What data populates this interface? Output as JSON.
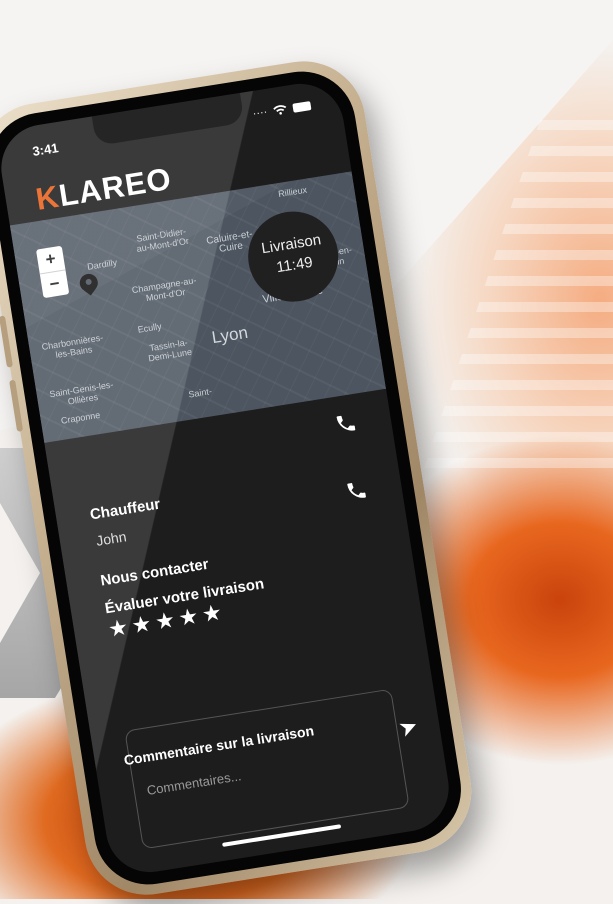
{
  "status_bar": {
    "time": "3:41",
    "signal": "····",
    "wifi_icon": "wifi-icon",
    "battery_icon": "battery-icon"
  },
  "app": {
    "logo_initial": "K",
    "logo_rest": "LAREO",
    "accent": "#e8601a"
  },
  "map": {
    "zoom_in": "+",
    "zoom_out": "−",
    "labels": [
      "Rillieux",
      "Saint-Didier-au-Mont-d'Or",
      "Caluire-et-Cuire",
      "Champagne-au-Mont-d'Or",
      "Charbonnières-les-Bains",
      "Ecully",
      "Tassin-la-Demi-Lune",
      "Lyon",
      "Villeurbanne",
      "Saint-Genis-les-Ollières",
      "Craponne",
      "Saint-",
      "Dardilly",
      "Vaulx-en-Velin"
    ],
    "delivery": {
      "label": "Livraison",
      "time": "11:49"
    }
  },
  "driver": {
    "title": "Chauffeur",
    "name": "John"
  },
  "contact": {
    "title": "Nous contacter"
  },
  "rating": {
    "title": "Évaluer votre livraison",
    "stars": 5,
    "star": "★"
  },
  "comment": {
    "title": "Commentaire sur la livraison",
    "placeholder": "Commentaires..."
  }
}
